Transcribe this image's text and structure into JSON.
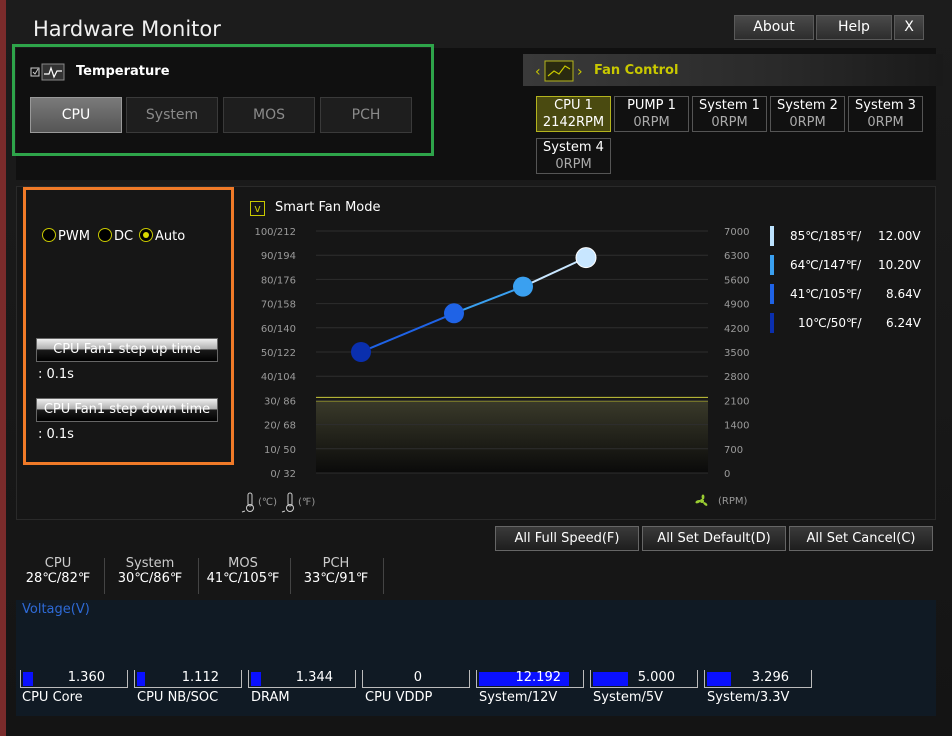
{
  "title": "Hardware Monitor",
  "top_buttons": {
    "about": "About",
    "help": "Help",
    "close": "X"
  },
  "temperature": {
    "label": "Temperature",
    "tabs": [
      "CPU",
      "System",
      "MOS",
      "PCH"
    ],
    "active_tab": "CPU"
  },
  "fan_control": {
    "label": "Fan Control",
    "fans": [
      {
        "name": "CPU 1",
        "value": "2142RPM",
        "active": true
      },
      {
        "name": "PUMP 1",
        "value": "0RPM"
      },
      {
        "name": "System 1",
        "value": "0RPM"
      },
      {
        "name": "System 2",
        "value": "0RPM"
      },
      {
        "name": "System 3",
        "value": "0RPM"
      },
      {
        "name": "System 4",
        "value": "0RPM"
      }
    ]
  },
  "mode": {
    "options": [
      "PWM",
      "DC",
      "Auto"
    ],
    "selected": "Auto",
    "step_up_label": "CPU Fan1 step up time",
    "step_up_value": ": 0.1s",
    "step_down_label": "CPU Fan1 step down time",
    "step_down_value": ": 0.1s"
  },
  "smart_fan": {
    "check_mark": "v",
    "label": "Smart Fan Mode",
    "temp_unit_c": "(℃)",
    "temp_unit_f": "(℉)",
    "rpm_unit": "(RPM)"
  },
  "chart_data": {
    "type": "line",
    "left_ticks": [
      "100/212",
      "90/194",
      "80/176",
      "70/158",
      "60/140",
      "50/122",
      "40/104",
      "30/ 86",
      "20/ 68",
      "10/ 50",
      "0/ 32"
    ],
    "right_ticks": [
      "7000",
      "6300",
      "5600",
      "4900",
      "4200",
      "3500",
      "2800",
      "2100",
      "1400",
      "700",
      "0"
    ],
    "x": [
      1,
      2,
      3,
      4
    ],
    "y_percent": [
      50,
      66,
      77,
      89
    ],
    "current_line_percent": 30,
    "point_colors": [
      "#0a2fae",
      "#1f63e6",
      "#3aa0f0",
      "#c8e6ff"
    ]
  },
  "legend": [
    {
      "temp": "85℃/185℉/",
      "volt": "12.00V",
      "color": "#bde3ff"
    },
    {
      "temp": "64℃/147℉/",
      "volt": "10.20V",
      "color": "#3aa0f0"
    },
    {
      "temp": "41℃/105℉/",
      "volt": "8.64V",
      "color": "#1f63e6"
    },
    {
      "temp": "10℃/50℉/",
      "volt": "6.24V",
      "color": "#0a2fae"
    }
  ],
  "actions": {
    "full_speed": "All Full Speed(F)",
    "set_default": "All Set Default(D)",
    "set_cancel": "All Set Cancel(C)"
  },
  "temps": [
    {
      "name": "CPU",
      "value": "28℃/82℉"
    },
    {
      "name": "System",
      "value": "30℃/86℉"
    },
    {
      "name": "MOS",
      "value": "41℃/105℉"
    },
    {
      "name": "PCH",
      "value": "33℃/91℉"
    }
  ],
  "voltage": {
    "title": "Voltage(V)",
    "items": [
      {
        "name": "CPU Core",
        "value": "1.360",
        "fill": 0.1
      },
      {
        "name": "CPU NB/SOC",
        "value": "1.112",
        "fill": 0.08
      },
      {
        "name": "DRAM",
        "value": "1.344",
        "fill": 0.1
      },
      {
        "name": "CPU VDDP",
        "value": "0",
        "fill": 0
      },
      {
        "name": "System/12V",
        "value": "12.192",
        "fill": 0.9
      },
      {
        "name": "System/5V",
        "value": "5.000",
        "fill": 0.35
      },
      {
        "name": "System/3.3V",
        "value": "3.296",
        "fill": 0.24
      }
    ]
  }
}
